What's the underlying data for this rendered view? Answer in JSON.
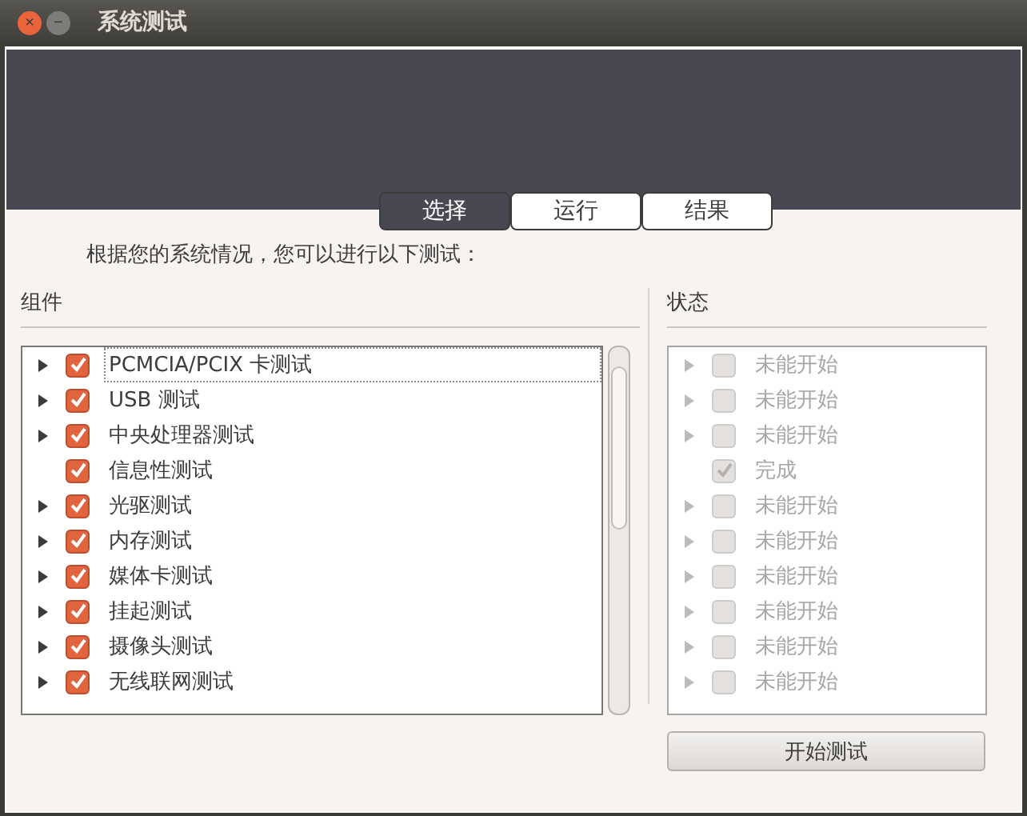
{
  "window": {
    "title": "系统测试",
    "buttons": [
      "×",
      "−"
    ]
  },
  "tabs": [
    {
      "label": "选择",
      "selected": true
    },
    {
      "label": "运行",
      "selected": false
    },
    {
      "label": "结果",
      "selected": false
    }
  ],
  "instruction": "根据您的系统情况，您可以进行以下测试：",
  "components": {
    "heading": "组件",
    "items": [
      {
        "label": "PCMCIA/PCIX 卡测试",
        "expandable": true,
        "checked": true,
        "focused": true
      },
      {
        "label": "USB 测试",
        "expandable": true,
        "checked": true,
        "focused": false
      },
      {
        "label": "中央处理器测试",
        "expandable": true,
        "checked": true,
        "focused": false
      },
      {
        "label": "信息性测试",
        "expandable": false,
        "checked": true,
        "focused": false
      },
      {
        "label": "光驱测试",
        "expandable": true,
        "checked": true,
        "focused": false
      },
      {
        "label": "内存测试",
        "expandable": true,
        "checked": true,
        "focused": false
      },
      {
        "label": "媒体卡测试",
        "expandable": true,
        "checked": true,
        "focused": false
      },
      {
        "label": "挂起测试",
        "expandable": true,
        "checked": true,
        "focused": false
      },
      {
        "label": "摄像头测试",
        "expandable": true,
        "checked": true,
        "focused": false
      },
      {
        "label": "无线联网测试",
        "expandable": true,
        "checked": true,
        "focused": false
      }
    ]
  },
  "status": {
    "heading": "状态",
    "items": [
      {
        "label": "未能开始",
        "expandable": true,
        "checked": false
      },
      {
        "label": "未能开始",
        "expandable": true,
        "checked": false
      },
      {
        "label": "未能开始",
        "expandable": true,
        "checked": false
      },
      {
        "label": "完成",
        "expandable": false,
        "checked": true
      },
      {
        "label": "未能开始",
        "expandable": true,
        "checked": false
      },
      {
        "label": "未能开始",
        "expandable": true,
        "checked": false
      },
      {
        "label": "未能开始",
        "expandable": true,
        "checked": false
      },
      {
        "label": "未能开始",
        "expandable": true,
        "checked": false
      },
      {
        "label": "未能开始",
        "expandable": true,
        "checked": false
      },
      {
        "label": "未能开始",
        "expandable": true,
        "checked": false
      }
    ]
  },
  "start_button": "开始测试"
}
